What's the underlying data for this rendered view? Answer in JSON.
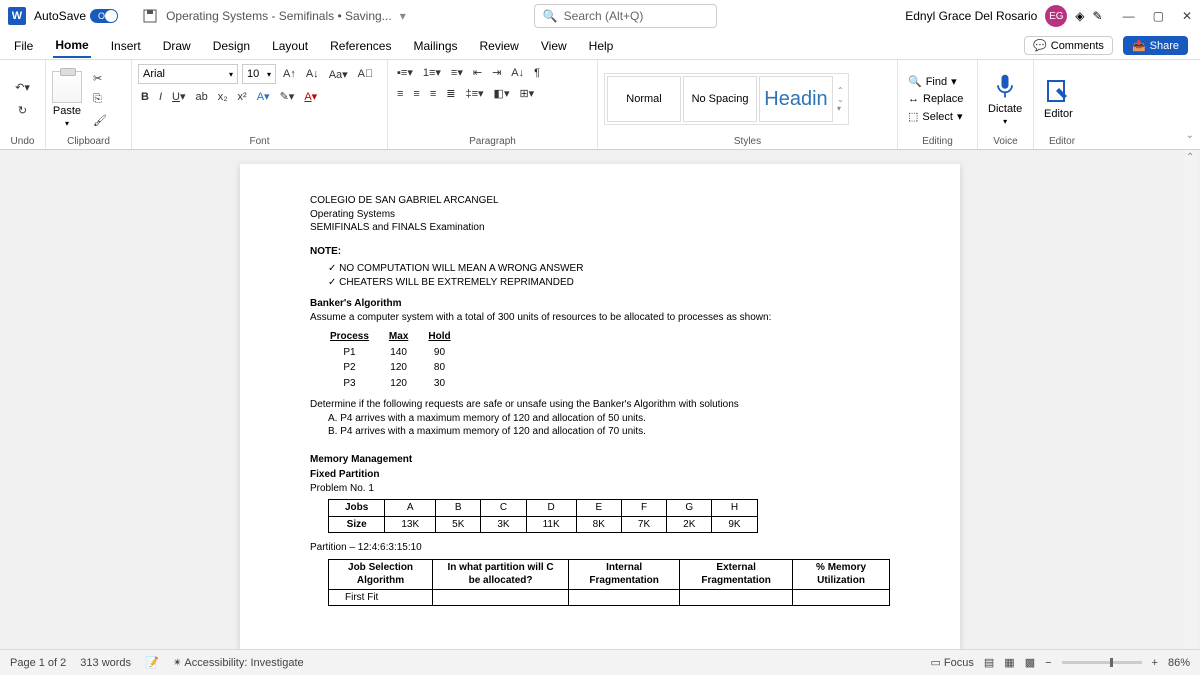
{
  "title_bar": {
    "autosave": "AutoSave",
    "autosave_state": "On",
    "doc_title": "Operating Systems - Semifinals • Saving...",
    "search_placeholder": "Search (Alt+Q)",
    "user": "Ednyl Grace Del Rosario",
    "badge": "EG"
  },
  "tabs": [
    "File",
    "Home",
    "Insert",
    "Draw",
    "Design",
    "Layout",
    "References",
    "Mailings",
    "Review",
    "View",
    "Help"
  ],
  "tabs_right": {
    "comments": "Comments",
    "share": "Share"
  },
  "ribbon": {
    "undo": "Undo",
    "clipboard": "Clipboard",
    "paste": "Paste",
    "font_group": "Font",
    "font_name": "Arial",
    "font_size": "10",
    "paragraph": "Paragraph",
    "styles": "Styles",
    "style_normal": "Normal",
    "style_nospacing": "No Spacing",
    "style_heading": "Headin",
    "editing": "Editing",
    "find": "Find",
    "replace": "Replace",
    "select": "Select",
    "dictate": "Dictate",
    "voice": "Voice",
    "editor": "Editor"
  },
  "doc": {
    "l1": "COLEGIO DE SAN GABRIEL ARCANGEL",
    "l2": "Operating Systems",
    "l3": "SEMIFINALS and FINALS Examination",
    "note": "NOTE:",
    "n1": "NO COMPUTATION WILL MEAN A WRONG ANSWER",
    "n2": "CHEATERS WILL BE EXTREMELY REPRIMANDED",
    "bankers": "Banker's Algorithm",
    "assume": "Assume a computer system with a total of 300 units of resources to be allocated to processes as shown:",
    "proc_h": [
      "Process",
      "Max",
      "Hold"
    ],
    "proc": [
      [
        "P1",
        "140",
        "90"
      ],
      [
        "P2",
        "120",
        "80"
      ],
      [
        "P3",
        "120",
        "30"
      ]
    ],
    "det": "Determine if the following requests are safe or unsafe using the Banker's Algorithm with solutions",
    "qa": "A.   P4 arrives with a maximum memory of 120 and allocation of 50 units.",
    "qb": "B.   P4 arrives with a maximum memory of 120 and allocation of 70 units.",
    "mm": "Memory Management",
    "fp": "Fixed Partition",
    "pn": "Problem No. 1",
    "jobs_h": [
      "Jobs",
      "A",
      "B",
      "C",
      "D",
      "E",
      "F",
      "G",
      "H"
    ],
    "jobs_s": [
      "Size",
      "13K",
      "5K",
      "3K",
      "11K",
      "8K",
      "7K",
      "2K",
      "9K"
    ],
    "part": "Partition – 12:4:6:3:15:10",
    "alg_h": [
      "Job Selection Algorithm",
      "In what partition will C be allocated?",
      "Internal Fragmentation",
      "External Fragmentation",
      "% Memory Utilization"
    ],
    "ff": "First Fit"
  },
  "status": {
    "page": "Page 1 of 2",
    "words": "313 words",
    "acc": "Accessibility: Investigate",
    "focus": "Focus",
    "zoom": "86%"
  }
}
